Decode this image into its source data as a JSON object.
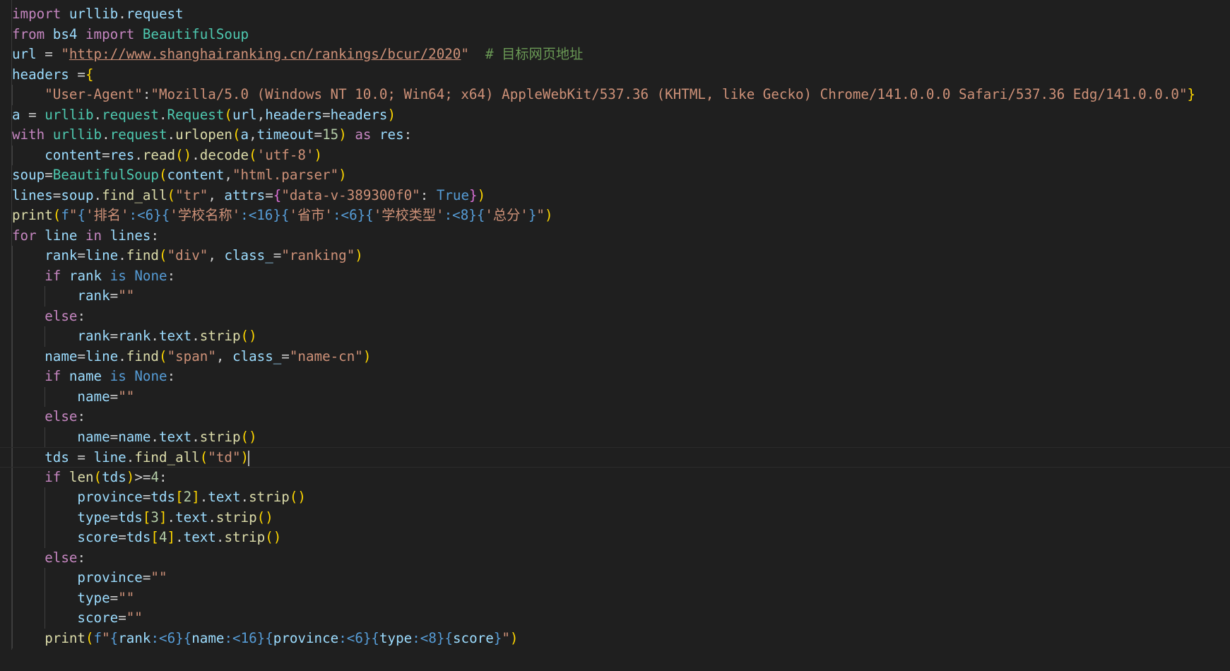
{
  "editor": {
    "language": "python",
    "theme_background": "#1f1f1f",
    "current_line": 23,
    "lines": [
      "import urllib.request",
      "from bs4 import BeautifulSoup",
      "url = \"http://www.shanghairanking.cn/rankings/bcur/2020\"  # 目标网页地址",
      "headers ={",
      "    \"User-Agent\":\"Mozilla/5.0 (Windows NT 10.0; Win64; x64) AppleWebKit/537.36 (KHTML, like Gecko) Chrome/141.0.0.0 Safari/537.36 Edg/141.0.0.0\"}",
      "a = urllib.request.Request(url,headers=headers)",
      "with urllib.request.urlopen(a,timeout=15) as res:",
      "    content=res.read().decode('utf-8')",
      "soup=BeautifulSoup(content,\"html.parser\")",
      "lines=soup.find_all(\"tr\", attrs={\"data-v-389300f0\": True})",
      "print(f\"{'排名':<6}{'学校名称':<16}{'省市':<6}{'学校类型':<8}{'总分'}\")",
      "for line in lines:",
      "    rank=line.find(\"div\", class_=\"ranking\")",
      "    if rank is None:",
      "        rank=\"\"",
      "    else:",
      "        rank=rank.text.strip()",
      "    name=line.find(\"span\", class_=\"name-cn\")",
      "    if name is None:",
      "        name=\"\"",
      "    else:",
      "        name=name.text.strip()",
      "    tds = line.find_all(\"td\")",
      "    if len(tds)>=4:",
      "        province=tds[2].text.strip()",
      "        type=tds[3].text.strip()",
      "        score=tds[4].text.strip()",
      "    else:",
      "        province=\"\"",
      "        type=\"\"",
      "        score=\"\"",
      "    print(f\"{rank:<6}{name:<16}{province:<6}{type:<8}{score}\")"
    ]
  },
  "tokens": {
    "kw_import": "import",
    "kw_from": "from",
    "kw_with": "with",
    "kw_as": "as",
    "kw_for": "for",
    "kw_in": "in",
    "kw_if": "if",
    "kw_is": "is",
    "kw_else": "else",
    "kw_none": "None",
    "kw_true": "True",
    "mod_urllib": "urllib",
    "mod_request": "request",
    "mod_bs4": "bs4",
    "cls_bs": "BeautifulSoup",
    "cls_request": "Request",
    "fn_urlopen": "urlopen",
    "fn_read": "read",
    "fn_decode": "decode",
    "fn_find_all": "find_all",
    "fn_find": "find",
    "fn_print": "print",
    "fn_strip": "strip",
    "fn_len": "len",
    "var_url": "url",
    "var_headers": "headers",
    "var_a": "a",
    "var_timeout": "timeout",
    "var_res": "res",
    "var_content": "content",
    "var_soup": "soup",
    "var_lines": "lines",
    "var_attrs": "attrs",
    "var_line": "line",
    "var_rank": "rank",
    "var_class": "class_",
    "var_text": "text",
    "var_name": "name",
    "var_tds": "tds",
    "var_province": "province",
    "var_type": "type",
    "var_score": "score",
    "str_url": "http://www.shanghairanking.cn/rankings/bcur/2020",
    "comment_target": "# 目标网页地址",
    "str_ua_key": "\"User-Agent\"",
    "str_ua_val": "\"Mozilla/5.0 (Windows NT 10.0; Win64; x64) AppleWebKit/537.36 (KHTML, like Gecko) Chrome/141.0.0.0 Safari/537.36 Edg/141.0.0.0\"",
    "str_utf8": "'utf-8'",
    "str_parser": "\"html.parser\"",
    "str_tr": "\"tr\"",
    "str_datav": "\"data-v-389300f0\"",
    "str_div": "\"div\"",
    "str_ranking": "\"ranking\"",
    "str_span": "\"span\"",
    "str_namecn": "\"name-cn\"",
    "str_td": "\"td\"",
    "str_empty": "\"\"",
    "str_h1": "'排名'",
    "str_h2": "'学校名称'",
    "str_h3": "'省市'",
    "str_h4": "'学校类型'",
    "str_h5": "'总分'",
    "num_15": "15",
    "num_4": "4",
    "num_2": "2",
    "num_3": "3",
    "num_4b": "4",
    "fmt_6": "<6",
    "fmt_16": "<16",
    "fmt_8": "<8"
  }
}
